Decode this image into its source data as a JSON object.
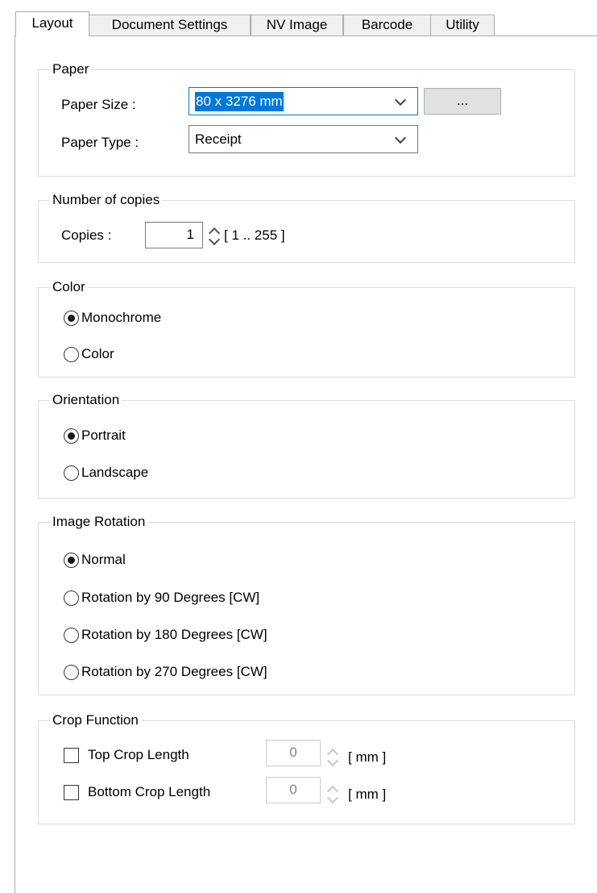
{
  "tabs": [
    {
      "label": "Layout",
      "active": true
    },
    {
      "label": "Document Settings",
      "active": false
    },
    {
      "label": "NV Image",
      "active": false
    },
    {
      "label": "Barcode",
      "active": false
    },
    {
      "label": "Utility",
      "active": false
    }
  ],
  "paper": {
    "title": "Paper",
    "size_label": "Paper Size :",
    "size_value": "80 x 3276 mm",
    "browse_button": "...",
    "type_label": "Paper Type :",
    "type_value": "Receipt"
  },
  "copies": {
    "title": "Number of copies",
    "label": "Copies :",
    "value": "1",
    "range": "[ 1 .. 255 ]"
  },
  "color": {
    "title": "Color",
    "options": [
      {
        "label": "Monochrome",
        "selected": true
      },
      {
        "label": "Color",
        "selected": false
      }
    ]
  },
  "orientation": {
    "title": "Orientation",
    "options": [
      {
        "label": "Portrait",
        "selected": true
      },
      {
        "label": "Landscape",
        "selected": false
      }
    ]
  },
  "rotation": {
    "title": "Image Rotation",
    "options": [
      {
        "label": "Normal",
        "selected": true
      },
      {
        "label": "Rotation by 90 Degrees [CW]",
        "selected": false
      },
      {
        "label": "Rotation by 180 Degrees [CW]",
        "selected": false
      },
      {
        "label": "Rotation by 270 Degrees [CW]",
        "selected": false
      }
    ]
  },
  "crop": {
    "title": "Crop Function",
    "items": [
      {
        "label": "Top Crop Length",
        "checked": false,
        "value": "0",
        "unit": "[ mm ]"
      },
      {
        "label": "Bottom Crop Length",
        "checked": false,
        "value": "0",
        "unit": "[ mm ]"
      }
    ]
  },
  "colors": {
    "focus_border": "#0078d7",
    "selection": "#0078d7"
  }
}
